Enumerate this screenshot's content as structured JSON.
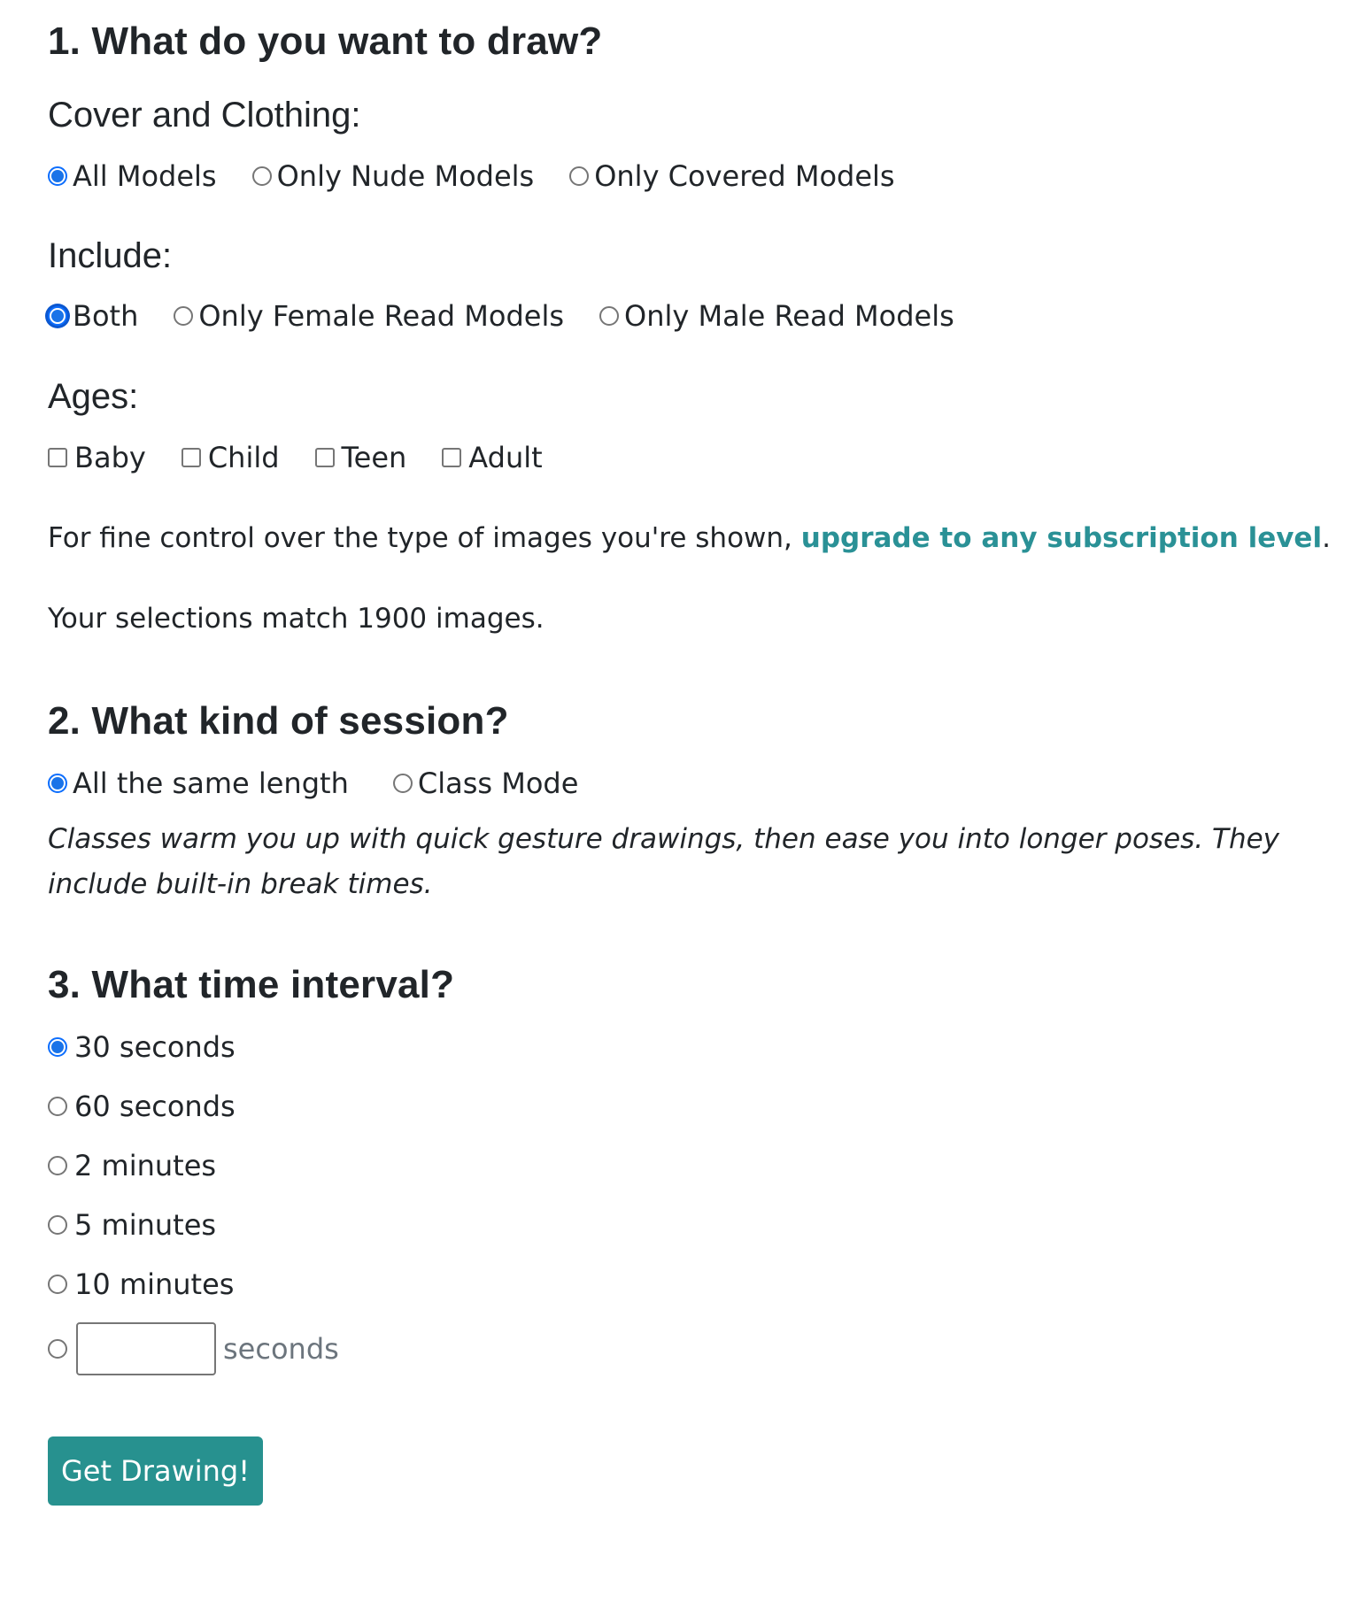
{
  "section1": {
    "heading": "1. What do you want to draw?",
    "cover": {
      "label": "Cover and Clothing:",
      "options": [
        "All Models",
        "Only Nude Models",
        "Only Covered Models"
      ],
      "selected": "All Models"
    },
    "include": {
      "label": "Include:",
      "options": [
        "Both",
        "Only Female Read Models",
        "Only Male Read Models"
      ],
      "selected": "Both"
    },
    "ages": {
      "label": "Ages:",
      "options": [
        "Baby",
        "Child",
        "Teen",
        "Adult"
      ],
      "checked": []
    },
    "upsell": {
      "prefix": "For fine control over the type of images you're shown, ",
      "link_text": "upgrade to any subscription level",
      "suffix": "."
    },
    "match_text": "Your selections match 1900 images."
  },
  "section2": {
    "heading": "2. What kind of session?",
    "options": [
      "All the same length",
      "Class Mode"
    ],
    "selected": "All the same length",
    "description": "Classes warm you up with quick gesture drawings, then ease you into longer poses. They include built-in break times."
  },
  "section3": {
    "heading": "3. What time interval?",
    "options": [
      "30 seconds",
      "60 seconds",
      "2 minutes",
      "5 minutes",
      "10 minutes"
    ],
    "selected": "30 seconds",
    "custom": {
      "value": "",
      "unit": "seconds"
    }
  },
  "submit_label": "Get Drawing!",
  "colors": {
    "accent": "#27918f",
    "radio_checked": "#1a73e8",
    "text": "#212529"
  }
}
